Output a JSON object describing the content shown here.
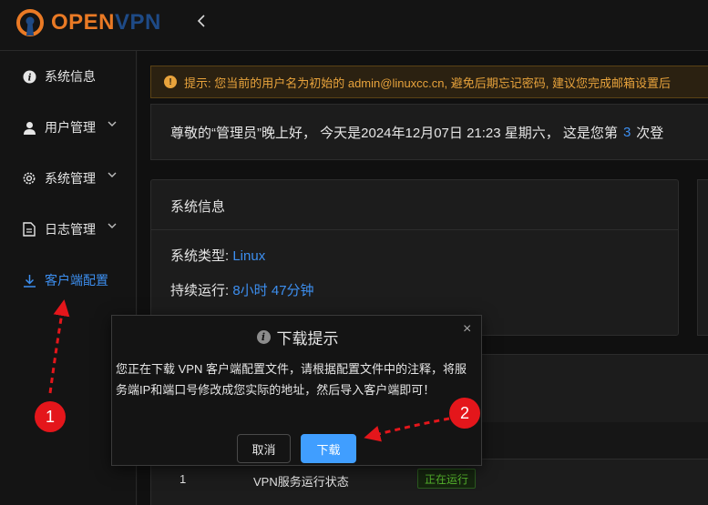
{
  "brand": {
    "prefix": "OPEN",
    "suffix": "VPN",
    "colors": {
      "orange": "#ea7a25",
      "navy": "#1e4a86"
    }
  },
  "header": {
    "collapse_icon": "chevron-left-icon"
  },
  "sidebar": {
    "items": [
      {
        "label": "系统信息",
        "icon": "info-icon"
      },
      {
        "label": "用户管理",
        "icon": "user-icon"
      },
      {
        "label": "系统管理",
        "icon": "gear-icon"
      },
      {
        "label": "日志管理",
        "icon": "document-icon"
      },
      {
        "label": "客户端配置",
        "icon": "download-icon",
        "active": true
      }
    ]
  },
  "alert": {
    "text": "提示: 您当前的用户名为初始的 admin@linuxcc.cn, 避免后期忘记密码, 建议您完成邮箱设置后"
  },
  "greeting": {
    "text": "尊敬的“管理员”晚上好， 今天是2024年12月07日 21:23 星期六， 这是您第",
    "count": "3",
    "suffix": "次登"
  },
  "system_card": {
    "title": "系统信息",
    "type_label": "系统类型:",
    "type_value": "Linux",
    "uptime_label": "持续运行:",
    "uptime_value": "8小时 47分钟"
  },
  "status_table": {
    "rows": [
      {
        "index": "1",
        "name": "VPN服务运行状态",
        "status": "正在运行"
      }
    ]
  },
  "modal": {
    "title": "下载提示",
    "body": "您正在下载 VPN 客户端配置文件，请根据配置文件中的注释，将服务端IP和端口号修改成您实际的地址，然后导入客户端即可！",
    "cancel": "取消",
    "confirm": "下载",
    "close": "×"
  },
  "annotations": {
    "marker1": "1",
    "marker2": "2",
    "color": "#e4161b"
  }
}
